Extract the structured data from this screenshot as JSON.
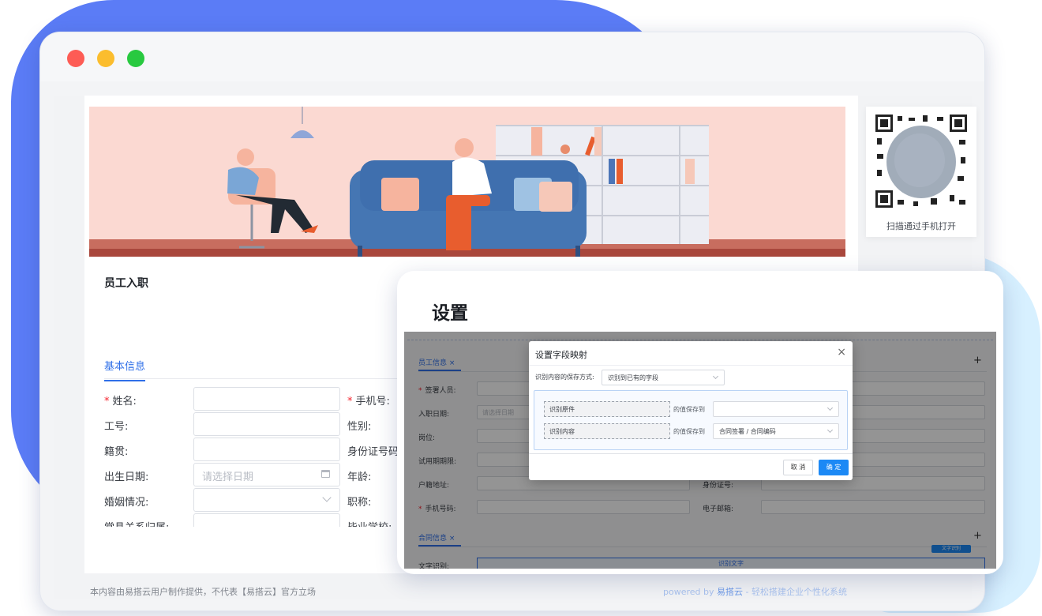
{
  "form": {
    "title": "员工入职",
    "tab_basic": "基本信息",
    "rows": [
      {
        "label": "姓名:",
        "required": true,
        "right_label": "手机号:",
        "right_required": true,
        "placeholder": ""
      },
      {
        "label": "工号:",
        "required": false,
        "right_label": "性别:",
        "right_required": false,
        "placeholder": ""
      },
      {
        "label": "籍贯:",
        "required": false,
        "right_label": "身份证号码",
        "right_required": false,
        "placeholder": ""
      },
      {
        "label": "出生日期:",
        "required": false,
        "right_label": "年龄:",
        "right_required": false,
        "placeholder": "请选择日期"
      },
      {
        "label": "婚姻情况:",
        "required": false,
        "right_label": "职称:",
        "right_required": false,
        "placeholder": ""
      },
      {
        "label": "常具关系归属:",
        "required": false,
        "right_label": "毕业学校:",
        "right_required": false,
        "placeholder": ""
      }
    ]
  },
  "qr": {
    "caption": "扫描通过手机打开"
  },
  "footer": {
    "disclaimer": "本内容由易搭云用户制作提供，不代表【易搭云】官方立场",
    "powered_prefix": "powered by",
    "powered_brand": "易搭云",
    "powered_suffix": "- 轻松搭建企业个性化系统"
  },
  "settings": {
    "title": "设置",
    "bg_form": {
      "tab_employee": "员工信息 ×",
      "tab_contract": "合同信息 ×",
      "plus": "+",
      "fields": [
        "签署人员:",
        "入职日期:",
        "岗位:",
        "试用期期限:",
        "户籍地址:",
        "手机号码:"
      ],
      "right_fields": [
        "身份证号:",
        "电子邮箱:"
      ],
      "date_placeholder": "请选择日期",
      "ocr_label": "文字识别:",
      "ocr_button": "识别文字",
      "ocr_toolbar": "文字识别"
    },
    "dialog": {
      "title": "设置字段映射",
      "close": "×",
      "save_mode_label": "识别内容的保存方式:",
      "save_mode_value": "识别到已有的字段",
      "mappings": [
        {
          "source": "识别原件",
          "save_label": "的值保存到",
          "target": ""
        },
        {
          "source": "识别内容",
          "save_label": "的值保存到",
          "target": "合同签署 / 合同编码"
        }
      ],
      "cancel": "取 消",
      "confirm": "确 定"
    }
  }
}
